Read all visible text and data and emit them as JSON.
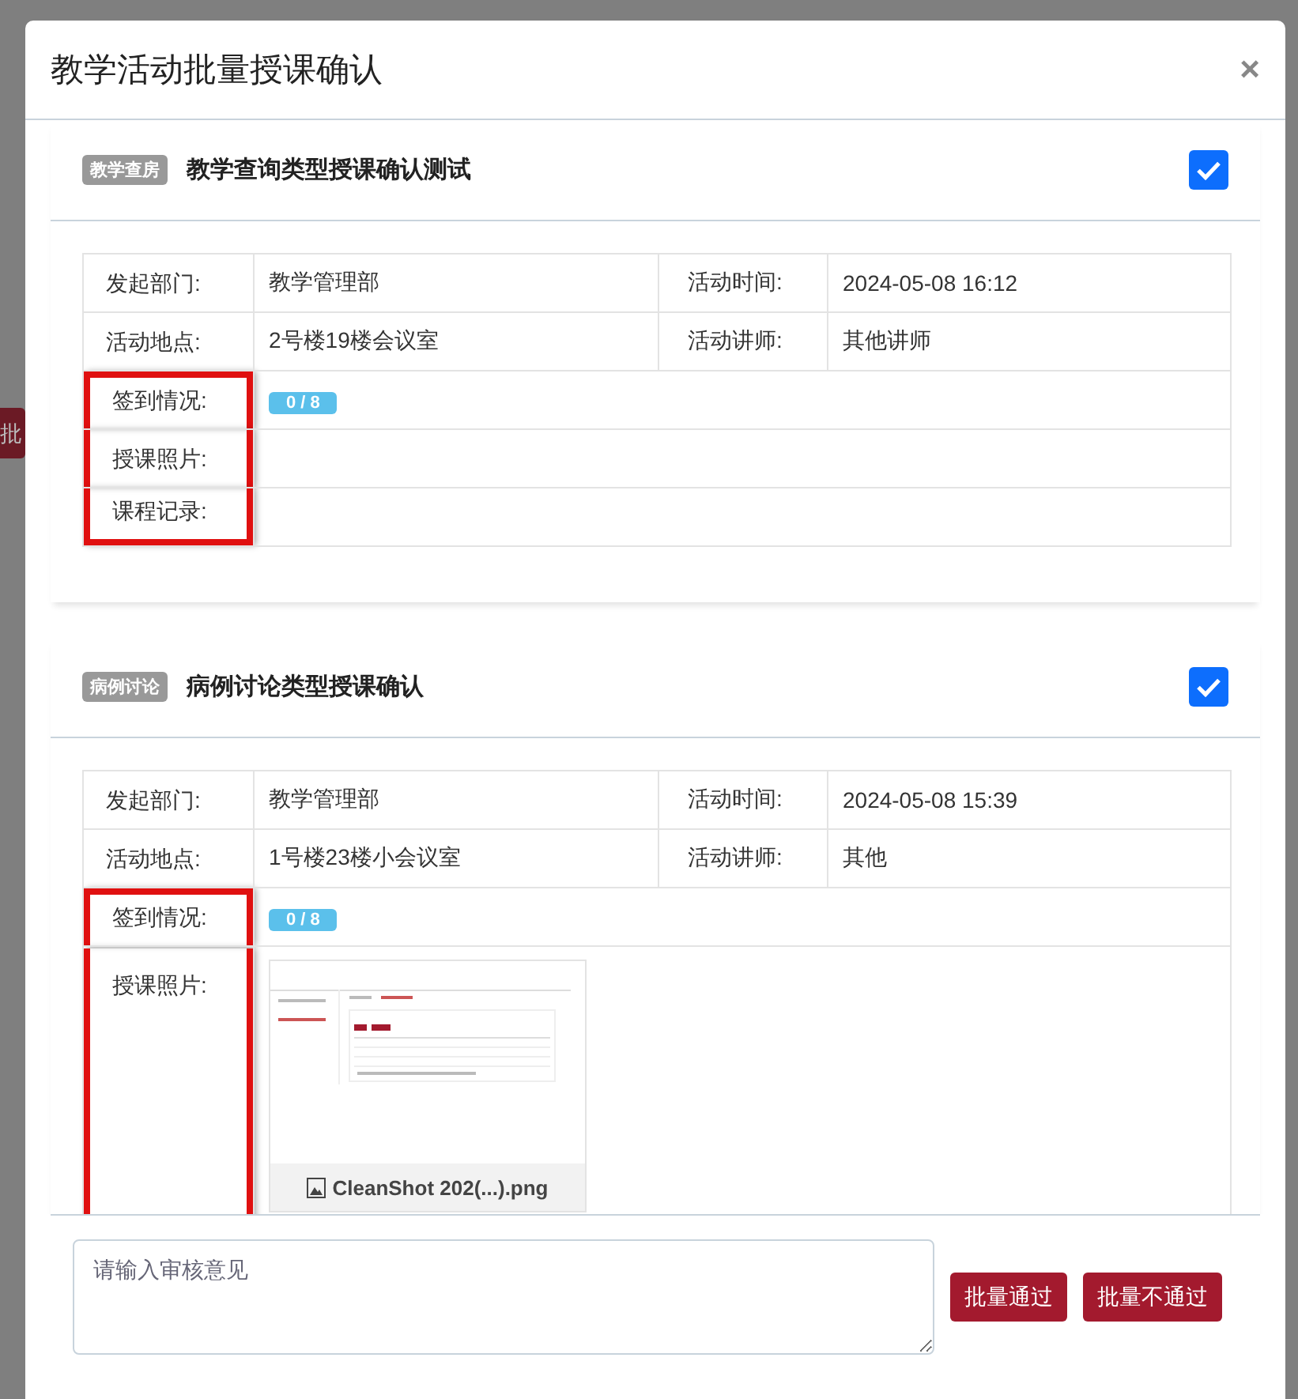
{
  "backdrop": {
    "button_fragment": "批"
  },
  "dialog": {
    "title": "教学活动批量授课确认",
    "close": "×"
  },
  "activities": [
    {
      "tag": "教学查房",
      "title": "教学查询类型授课确认测试",
      "checked": true,
      "fields": [
        {
          "kind": "pair",
          "label": "发起部门:",
          "value": "教学管理部",
          "label2": "活动时间:",
          "value2": "2024-05-08 16:12",
          "highlighted": false
        },
        {
          "kind": "pair",
          "label": "活动地点:",
          "value": "2号楼19楼会议室",
          "label2": "活动讲师:",
          "value2": "其他讲师",
          "highlighted": false
        },
        {
          "kind": "badge",
          "label": "签到情况:",
          "value": "0 / 8",
          "highlighted": true
        },
        {
          "kind": "empty",
          "label": "授课照片:",
          "highlighted": true
        },
        {
          "kind": "empty",
          "label": "课程记录:",
          "highlighted": true
        }
      ]
    },
    {
      "tag": "病例讨论",
      "title": "病例讨论类型授课确认",
      "checked": true,
      "fields": [
        {
          "kind": "pair",
          "label": "发起部门:",
          "value": "教学管理部",
          "label2": "活动时间:",
          "value2": "2024-05-08 15:39",
          "highlighted": false
        },
        {
          "kind": "pair",
          "label": "活动地点:",
          "value": "1号楼23楼小会议室",
          "label2": "活动讲师:",
          "value2": "其他",
          "highlighted": false
        },
        {
          "kind": "badge",
          "label": "签到情况:",
          "value": "0 / 8",
          "highlighted": true
        },
        {
          "kind": "image",
          "label": "授课照片:",
          "value": "CleanShot 202(...).png",
          "highlighted": true
        }
      ]
    }
  ],
  "footer": {
    "comment": {
      "placeholder": "请输入审核意见"
    },
    "buttons": [
      "批量通过",
      "批量不通过"
    ]
  }
}
